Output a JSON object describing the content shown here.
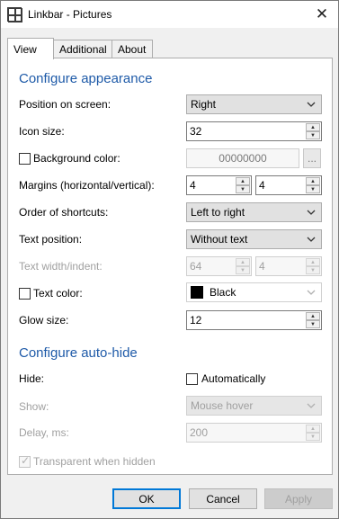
{
  "window": {
    "title": "Linkbar - Pictures",
    "close_glyph": "✕"
  },
  "tabs": [
    {
      "label": "View",
      "active": true
    },
    {
      "label": "Additional",
      "active": false
    },
    {
      "label": "About",
      "active": false
    }
  ],
  "appearance": {
    "heading": "Configure appearance",
    "position": {
      "label": "Position on screen:",
      "value": "Right"
    },
    "icon_size": {
      "label": "Icon size:",
      "value": "32"
    },
    "background": {
      "label": "Background color:",
      "value": "00000000",
      "checked": false,
      "ellipsis": "..."
    },
    "margins": {
      "label": "Margins (horizontal/vertical):",
      "horizontal": "4",
      "vertical": "4"
    },
    "order": {
      "label": "Order of shortcuts:",
      "value": "Left to right"
    },
    "text_position": {
      "label": "Text position:",
      "value": "Without text"
    },
    "text_width": {
      "label": "Text width/indent:",
      "width": "64",
      "indent": "4"
    },
    "text_color": {
      "label": "Text color:",
      "value": "Black",
      "checked": false,
      "swatch": "#000000"
    },
    "glow_size": {
      "label": "Glow size:",
      "value": "12"
    }
  },
  "autohide": {
    "heading": "Configure auto-hide",
    "hide": {
      "label": "Hide:",
      "option": "Automatically",
      "checked": false
    },
    "show": {
      "label": "Show:",
      "value": "Mouse hover"
    },
    "delay": {
      "label": "Delay, ms:",
      "value": "200"
    },
    "transparent": {
      "label": "Transparent when hidden",
      "checked": true
    }
  },
  "buttons": {
    "ok": "OK",
    "cancel": "Cancel",
    "apply": "Apply"
  },
  "colors": {
    "accent": "#1e5aa8",
    "default_button_border": "#0078d7"
  }
}
